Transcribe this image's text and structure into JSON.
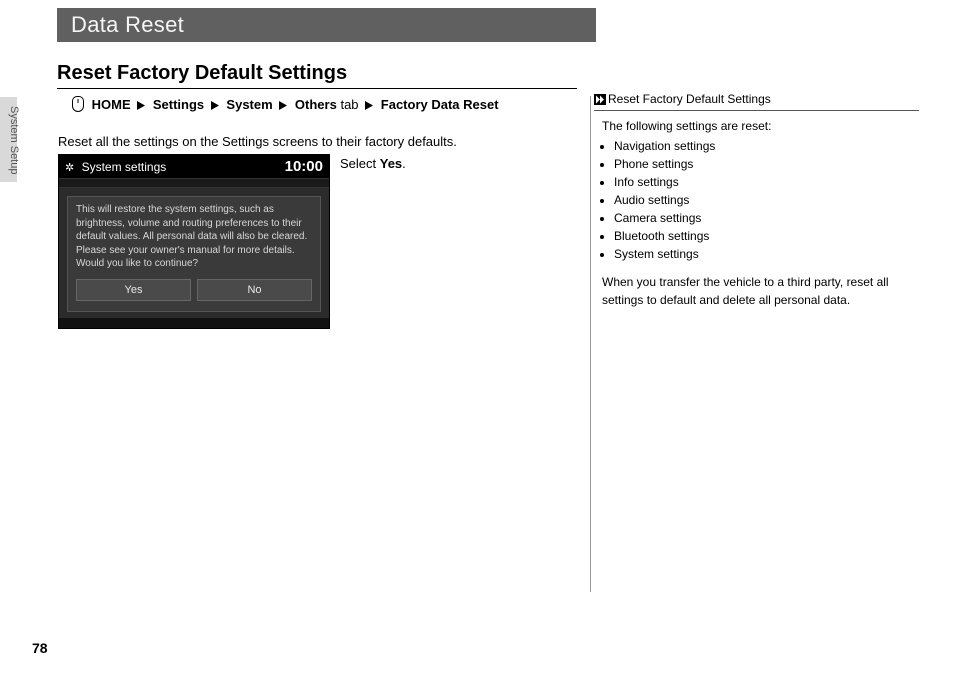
{
  "chapter_title": "Data Reset",
  "section_title": "Reset Factory Default Settings",
  "side_label": "System Setup",
  "breadcrumb": {
    "home": "HOME",
    "settings": "Settings",
    "system": "System",
    "others_label": "Others",
    "others_suffix": "tab",
    "factory": "Factory Data Reset"
  },
  "intro_text": "Reset all the settings on the Settings screens to their factory defaults.",
  "instruction_prefix": "Select ",
  "instruction_bold": "Yes",
  "instruction_suffix": ".",
  "screenshot": {
    "header_label": "System settings",
    "time": "10:00",
    "message": "This will restore the system settings, such as brightness, volume and routing preferences to their default values. All personal data will also be cleared. Please see your owner's manual for more details. Would you like to continue?",
    "yes": "Yes",
    "no": "No"
  },
  "sidebar": {
    "heading": "Reset Factory Default Settings",
    "lead": "The following settings are reset:",
    "items": [
      "Navigation settings",
      "Phone settings",
      "Info settings",
      "Audio settings",
      "Camera settings",
      "Bluetooth settings",
      "System settings"
    ],
    "note": "When you transfer the vehicle to a third party, reset all settings to default and delete all personal data."
  },
  "page_number": "78"
}
